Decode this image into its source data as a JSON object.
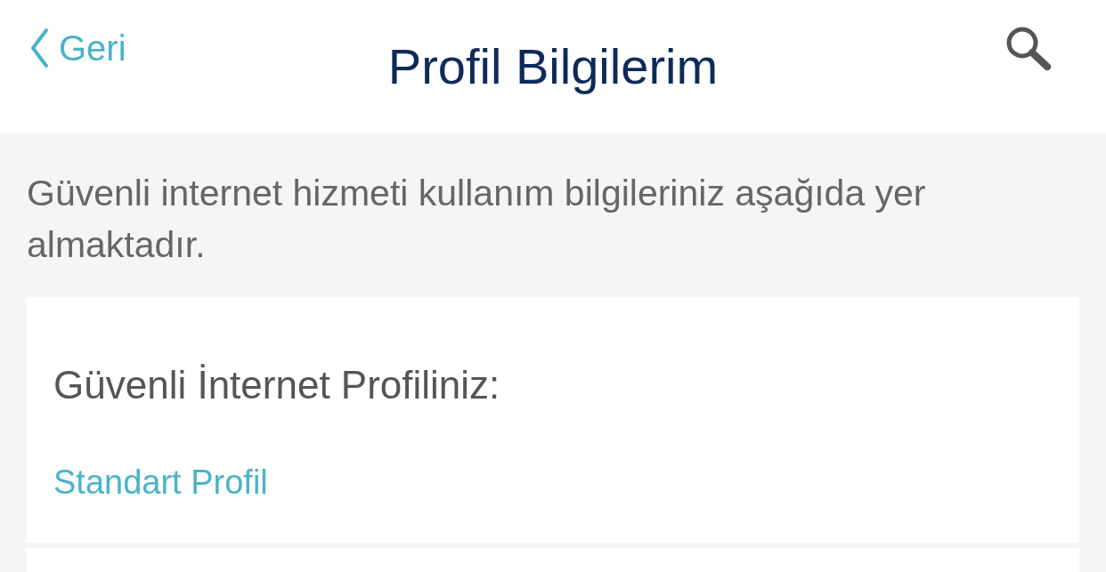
{
  "header": {
    "back_label": "Geri",
    "title": "Profil Bilgilerim"
  },
  "intro": "Güvenli internet hizmeti kullanım bilgileriniz aşağıda yer almaktadır.",
  "profile_card": {
    "heading": "Güvenli İnternet Profiliniz:",
    "value": "Standart Profil"
  }
}
